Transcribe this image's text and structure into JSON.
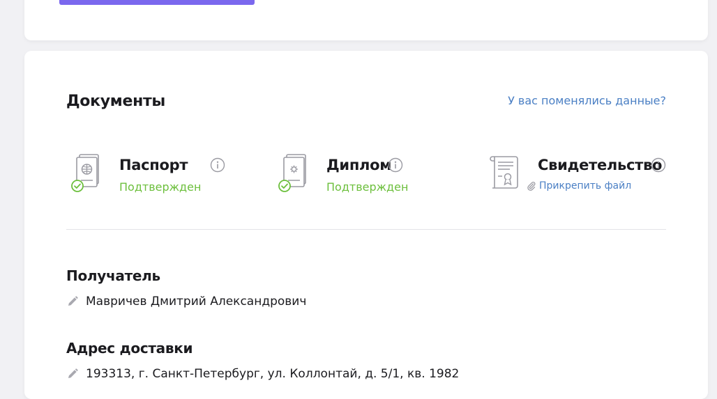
{
  "colors": {
    "accent": "#7b68ee",
    "link": "#4a7fc4",
    "success": "#6cbf3c",
    "icon_gray": "#9a9aa2"
  },
  "documents": {
    "title": "Документы",
    "changed_link": "У вас поменялись данные?",
    "items": [
      {
        "name": "Паспорт",
        "status": "Подтвержден",
        "icon": "passport-icon",
        "verified": true
      },
      {
        "name": "Диплом",
        "status": "Подтвержден",
        "icon": "diploma-icon",
        "verified": true
      },
      {
        "name": "Свидетельство",
        "action": "Прикрепить файл",
        "icon": "certificate-icon",
        "verified": false
      }
    ]
  },
  "recipient": {
    "title": "Получатель",
    "value": "Мавричев Дмитрий Александрович"
  },
  "delivery": {
    "title": "Адрес доставки",
    "value": "193313, г. Санкт-Петербург, ул. Коллонтай, д. 5/1, кв. 1982"
  }
}
